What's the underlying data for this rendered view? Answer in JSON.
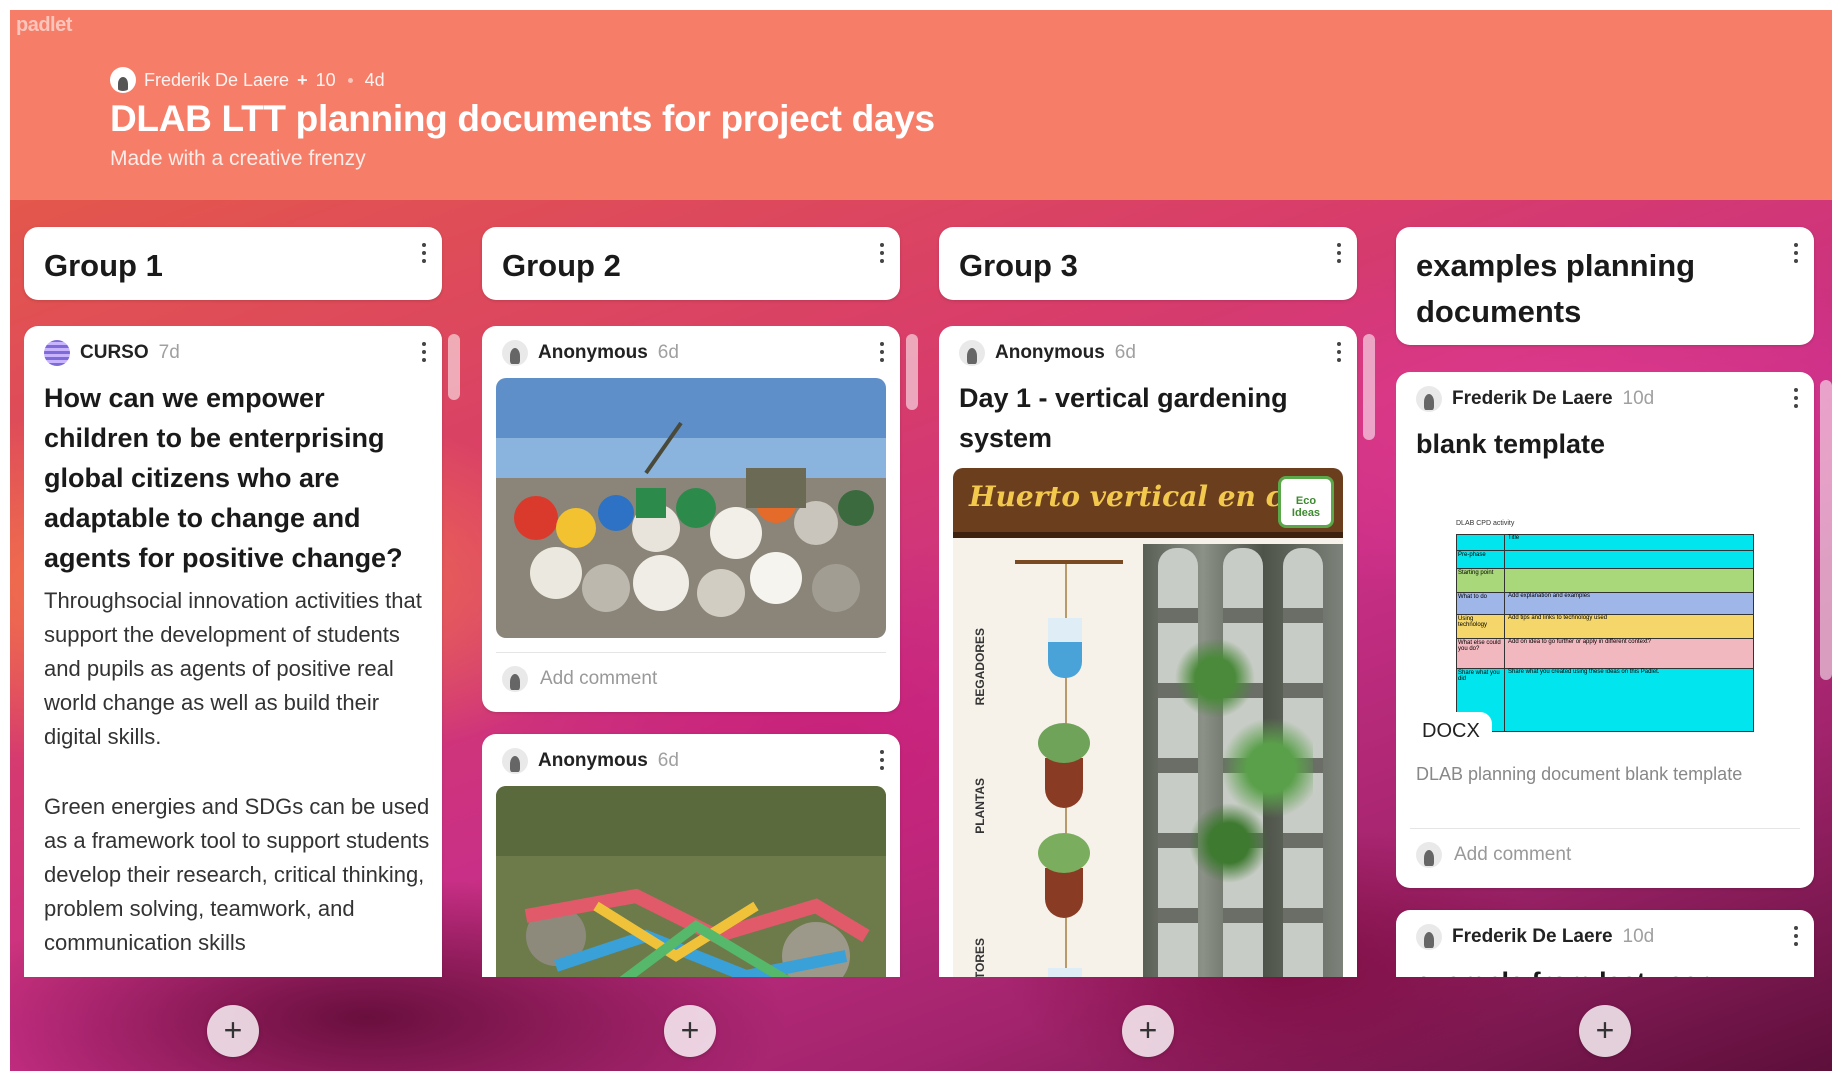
{
  "brand": "padlet",
  "header": {
    "author": "Frederik De Laere",
    "contributors": "10",
    "age": "4d",
    "title": "DLAB LTT planning documents for project days",
    "subtitle": "Made with a creative frenzy"
  },
  "columns": [
    {
      "title": "Group 1"
    },
    {
      "title": "Group 2"
    },
    {
      "title": "Group 3"
    },
    {
      "title": "examples planning documents"
    }
  ],
  "posts": {
    "g1p1": {
      "author": "CURSO",
      "age": "7d",
      "title": "How can we empower children to be enterprising global citizens who are adaptable to change and agents for positive change?",
      "body1": "Throughsocial innovation activities that support the development of students and pupils as agents of positive real world change as well as build their digital skills.",
      "body2": "Green energies and SDGs can be used as a framework tool to support students develop their research, critical thinking, problem solving, teamwork, and communication skills"
    },
    "g2p1": {
      "author": "Anonymous",
      "age": "6d",
      "comment_placeholder": "Add comment"
    },
    "g2p2": {
      "author": "Anonymous",
      "age": "6d"
    },
    "g3p1": {
      "author": "Anonymous",
      "age": "6d",
      "title": "Day 1 - vertical gardening system",
      "image_banner": "Huerto vertical en casa",
      "image_labels": [
        "REGADORES",
        "PLANTAS",
        "COLECTORES"
      ],
      "logo": "Eco Ideas"
    },
    "g4p1": {
      "author": "Frederik De Laere",
      "age": "10d",
      "title": "blank template",
      "file_type": "DOCX",
      "caption": "DLAB planning document blank template",
      "comment_placeholder": "Add comment",
      "doc_heading": "DLAB CPD activity",
      "doc_rows": [
        {
          "label": "",
          "text": "Title"
        },
        {
          "label": "Pre-phase",
          "text": ""
        },
        {
          "label": "Starting point",
          "text": ""
        },
        {
          "label": "What to do",
          "text": "Add explanation and examples"
        },
        {
          "label": "Using technology",
          "text": "Add tips and links to technology used"
        },
        {
          "label": "What else could you do?",
          "text": "Add on idea to go further or apply in different context?"
        },
        {
          "label": "Share what you did",
          "text": "Share what you created using these ideas on this Padlet."
        }
      ]
    },
    "g4p2": {
      "author": "Frederik De Laere",
      "age": "10d",
      "title_partial": "example from last year"
    }
  },
  "add_button": "+",
  "colors": {
    "header": "#f67e68",
    "card": "#ffffff",
    "doc_cyan": "#00e5ee",
    "doc_green": "#a8d87a",
    "doc_blue": "#9fb7e8",
    "doc_yellow": "#f5d66a",
    "doc_pink": "#f2b8c0"
  }
}
